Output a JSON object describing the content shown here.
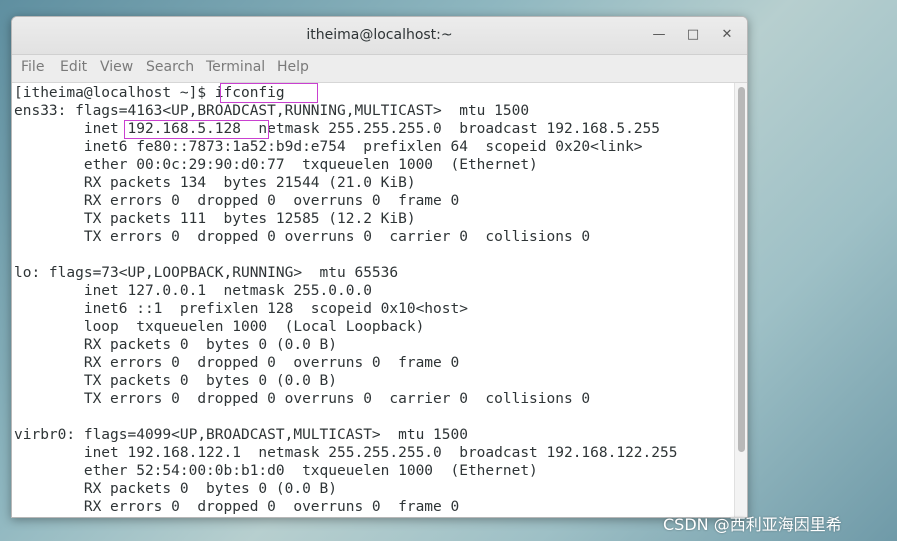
{
  "window": {
    "title": "itheima@localhost:~",
    "controls": {
      "minimize": "—",
      "maximize": "□",
      "close": "✕"
    }
  },
  "menu": [
    "File",
    "Edit",
    "View",
    "Search",
    "Terminal",
    "Help"
  ],
  "terminal": {
    "lines": [
      "[itheima@localhost ~]$ ifconfig",
      "ens33: flags=4163<UP,BROADCAST,RUNNING,MULTICAST>  mtu 1500",
      "        inet 192.168.5.128  netmask 255.255.255.0  broadcast 192.168.5.255",
      "        inet6 fe80::7873:1a52:b9d:e754  prefixlen 64  scopeid 0x20<link>",
      "        ether 00:0c:29:90:d0:77  txqueuelen 1000  (Ethernet)",
      "        RX packets 134  bytes 21544 (21.0 KiB)",
      "        RX errors 0  dropped 0  overruns 0  frame 0",
      "        TX packets 111  bytes 12585 (12.2 KiB)",
      "        TX errors 0  dropped 0 overruns 0  carrier 0  collisions 0",
      "",
      "lo: flags=73<UP,LOOPBACK,RUNNING>  mtu 65536",
      "        inet 127.0.0.1  netmask 255.0.0.0",
      "        inet6 ::1  prefixlen 128  scopeid 0x10<host>",
      "        loop  txqueuelen 1000  (Local Loopback)",
      "        RX packets 0  bytes 0 (0.0 B)",
      "        RX errors 0  dropped 0  overruns 0  frame 0",
      "        TX packets 0  bytes 0 (0.0 B)",
      "        TX errors 0  dropped 0 overruns 0  carrier 0  collisions 0",
      "",
      "virbr0: flags=4099<UP,BROADCAST,MULTICAST>  mtu 1500",
      "        inet 192.168.122.1  netmask 255.255.255.0  broadcast 192.168.122.255",
      "        ether 52:54:00:0b:b1:d0  txqueuelen 1000  (Ethernet)",
      "        RX packets 0  bytes 0 (0.0 B)",
      "        RX errors 0  dropped 0  overruns 0  frame 0"
    ]
  },
  "watermark": "CSDN @西利亚海因里希",
  "colors": {
    "highlight": "#c940d0"
  }
}
